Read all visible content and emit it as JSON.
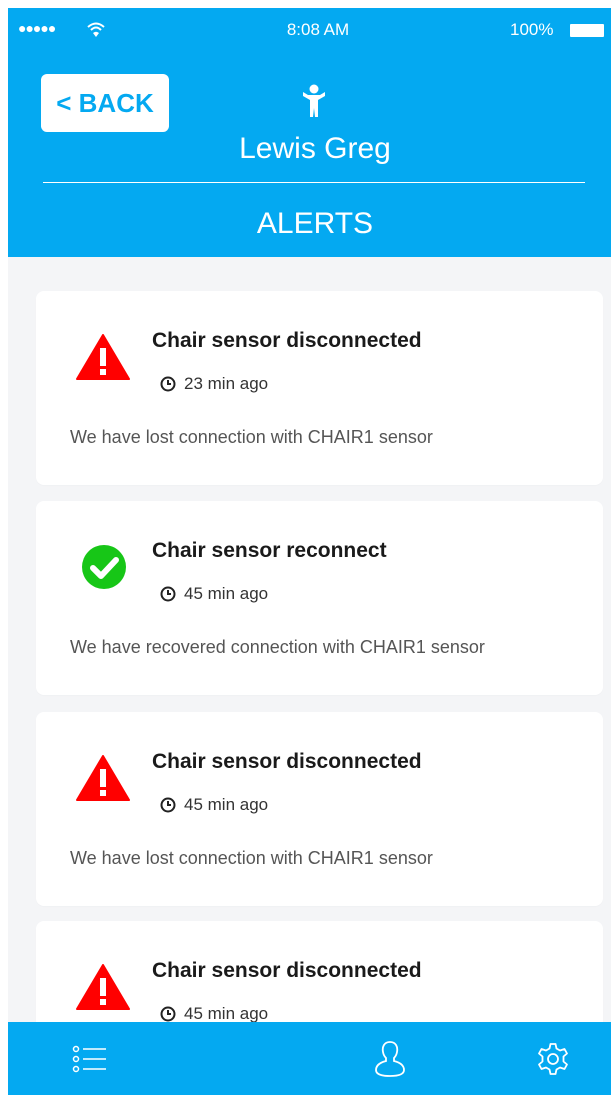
{
  "status_bar": {
    "signal": "●●●●●",
    "time": "8:08 AM",
    "battery": "100%"
  },
  "header": {
    "back_label": "< BACK",
    "user_name": "Lewis Greg",
    "section_title": "ALERTS"
  },
  "alerts": [
    {
      "type": "warning",
      "title": "Chair sensor disconnected",
      "time": "23 min ago",
      "message": "We have lost connection with CHAIR1 sensor"
    },
    {
      "type": "success",
      "title": "Chair sensor reconnect",
      "time": "45 min ago",
      "message": "We have recovered connection with CHAIR1 sensor"
    },
    {
      "type": "warning",
      "title": "Chair sensor disconnected",
      "time": "45 min ago",
      "message": "We have lost connection with CHAIR1 sensor"
    },
    {
      "type": "warning",
      "title": "Chair sensor disconnected",
      "time": "45 min ago",
      "message": ""
    }
  ],
  "tab_bar": {
    "items": [
      "list-icon",
      "user-icon",
      "gear-icon"
    ]
  },
  "colors": {
    "primary": "#04a9f1",
    "warning": "#ff0000",
    "success": "#17c617",
    "background": "#f4f5f7"
  }
}
